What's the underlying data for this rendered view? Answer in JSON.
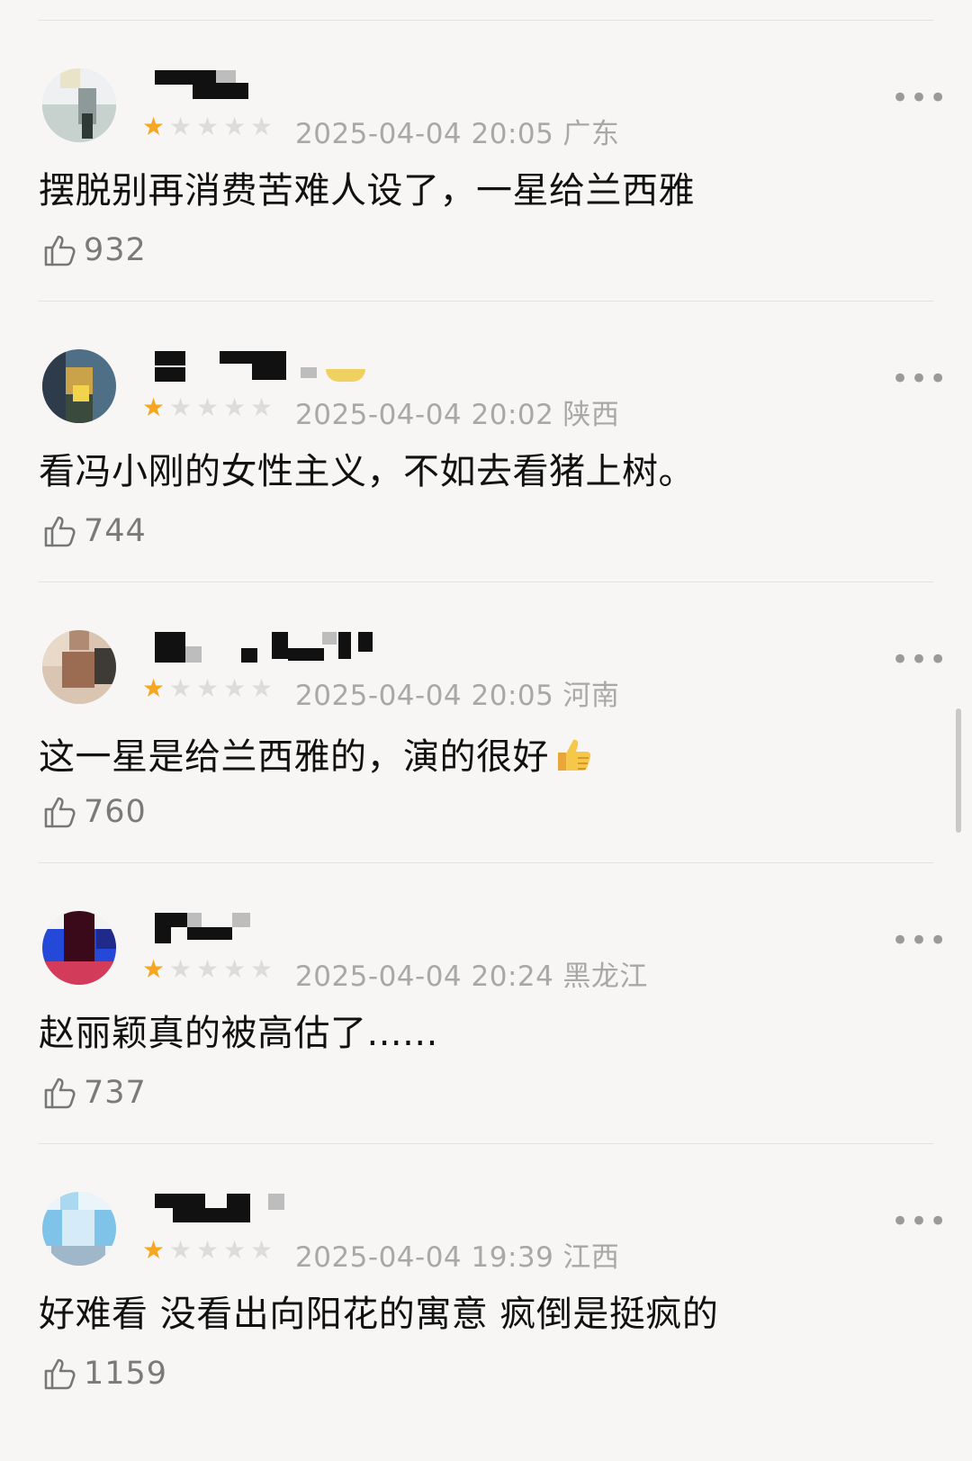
{
  "reviews": [
    {
      "rating": 1,
      "date": "2025-04-04 20:05",
      "region": "广东",
      "content": "摆脱别再消费苦难人设了，一星给兰西雅",
      "likes": "932",
      "avatar_colors": [
        "#eef0f2",
        "#c7d2cf",
        "#8e9a9a",
        "#2f3a36",
        "#e9e3c9"
      ]
    },
    {
      "rating": 1,
      "date": "2025-04-04 20:02",
      "region": "陕西",
      "content": "看冯小刚的女性主义，不如去看猪上树。",
      "likes": "744",
      "avatar_colors": [
        "#4f6f86",
        "#2d3b4a",
        "#c9a24a",
        "#3a4a3c",
        "#f2d34c"
      ]
    },
    {
      "rating": 1,
      "date": "2025-04-04 20:05",
      "region": "河南",
      "content": "这一星是给兰西雅的，演的很好",
      "likes": "760",
      "has_thumb_emoji": true,
      "avatar_colors": [
        "#d9c5b2",
        "#9b6b52",
        "#3e3a36",
        "#b08a73",
        "#e8d9c9"
      ]
    },
    {
      "rating": 1,
      "date": "2025-04-04 20:24",
      "region": "黑龙江",
      "content": "赵丽颖真的被高估了......",
      "likes": "737",
      "avatar_colors": [
        "#1f2a8a",
        "#3b0a1a",
        "#d23b5a",
        "#f3f3f3",
        "#2448d8"
      ]
    },
    {
      "rating": 1,
      "date": "2025-04-04 19:39",
      "region": "江西",
      "content": "好难看 没看出向阳花的寓意 疯倒是挺疯的",
      "likes": "1159",
      "avatar_colors": [
        "#a9d8f0",
        "#7fc3e8",
        "#d5ecf8",
        "#9fb7c9",
        "#e9f5fb"
      ]
    }
  ],
  "colors": {
    "background": "#f7f6f4",
    "star_on": "#f5a623",
    "star_off": "#dcdcdc",
    "meta_text": "#a8a8a8",
    "like_text": "#7a7a7a"
  },
  "icons": {
    "more": "more-dots-icon",
    "like": "thumbs-up-icon",
    "star": "star-icon"
  }
}
